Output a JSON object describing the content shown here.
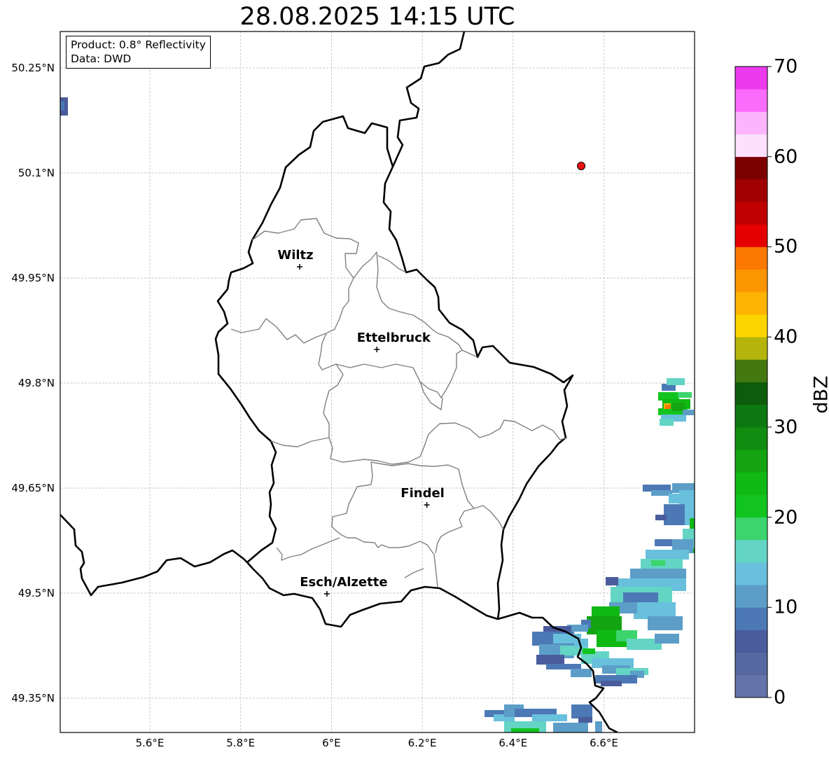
{
  "title": "28.08.2025 14:15 UTC",
  "info": {
    "product": "Product: 0.8° Reflectivity",
    "source": "Data: DWD"
  },
  "axes": {
    "y_ticks": [
      "50.25°N",
      "50.1°N",
      "49.95°N",
      "49.8°N",
      "49.65°N",
      "49.5°N",
      "49.35°N"
    ],
    "x_ticks": [
      "5.6°E",
      "5.8°E",
      "6°E",
      "6.2°E",
      "6.4°E",
      "6.6°E"
    ]
  },
  "cities": [
    {
      "name": "Wiltz",
      "lon": 5.93,
      "lat": 49.966
    },
    {
      "name": "Ettelbruck",
      "lon": 6.1,
      "lat": 49.848
    },
    {
      "name": "Findel",
      "lon": 6.21,
      "lat": 49.626
    },
    {
      "name": "Esch/Alzette",
      "lon": 5.99,
      "lat": 49.499
    }
  ],
  "marker": {
    "lon": 6.55,
    "lat": 50.11,
    "color": "#ee1111"
  },
  "colorbar": {
    "label": "dBZ",
    "ticks": [
      "0",
      "10",
      "20",
      "30",
      "40",
      "50",
      "60",
      "70"
    ],
    "min": 0,
    "max": 70,
    "step": 2.5,
    "colors": [
      "#6474a8",
      "#5668a0",
      "#4a5c9c",
      "#4c79b5",
      "#5c9ec8",
      "#68c0dc",
      "#64d4c4",
      "#3cd46c",
      "#12c41e",
      "#10b814",
      "#14a412",
      "#108c10",
      "#0c7810",
      "#0c5c0c",
      "#447810",
      "#b4b40c",
      "#fcd400",
      "#fcb400",
      "#fc9600",
      "#fc7800",
      "#e40000",
      "#c00000",
      "#a00000",
      "#7c0000",
      "#fce0fc",
      "#fcb4fc",
      "#fc6cfc",
      "#ec3aec"
    ]
  },
  "colors": {
    "border": "#000000",
    "canton_lines": "#808080",
    "grid": "#b8b8b8"
  }
}
